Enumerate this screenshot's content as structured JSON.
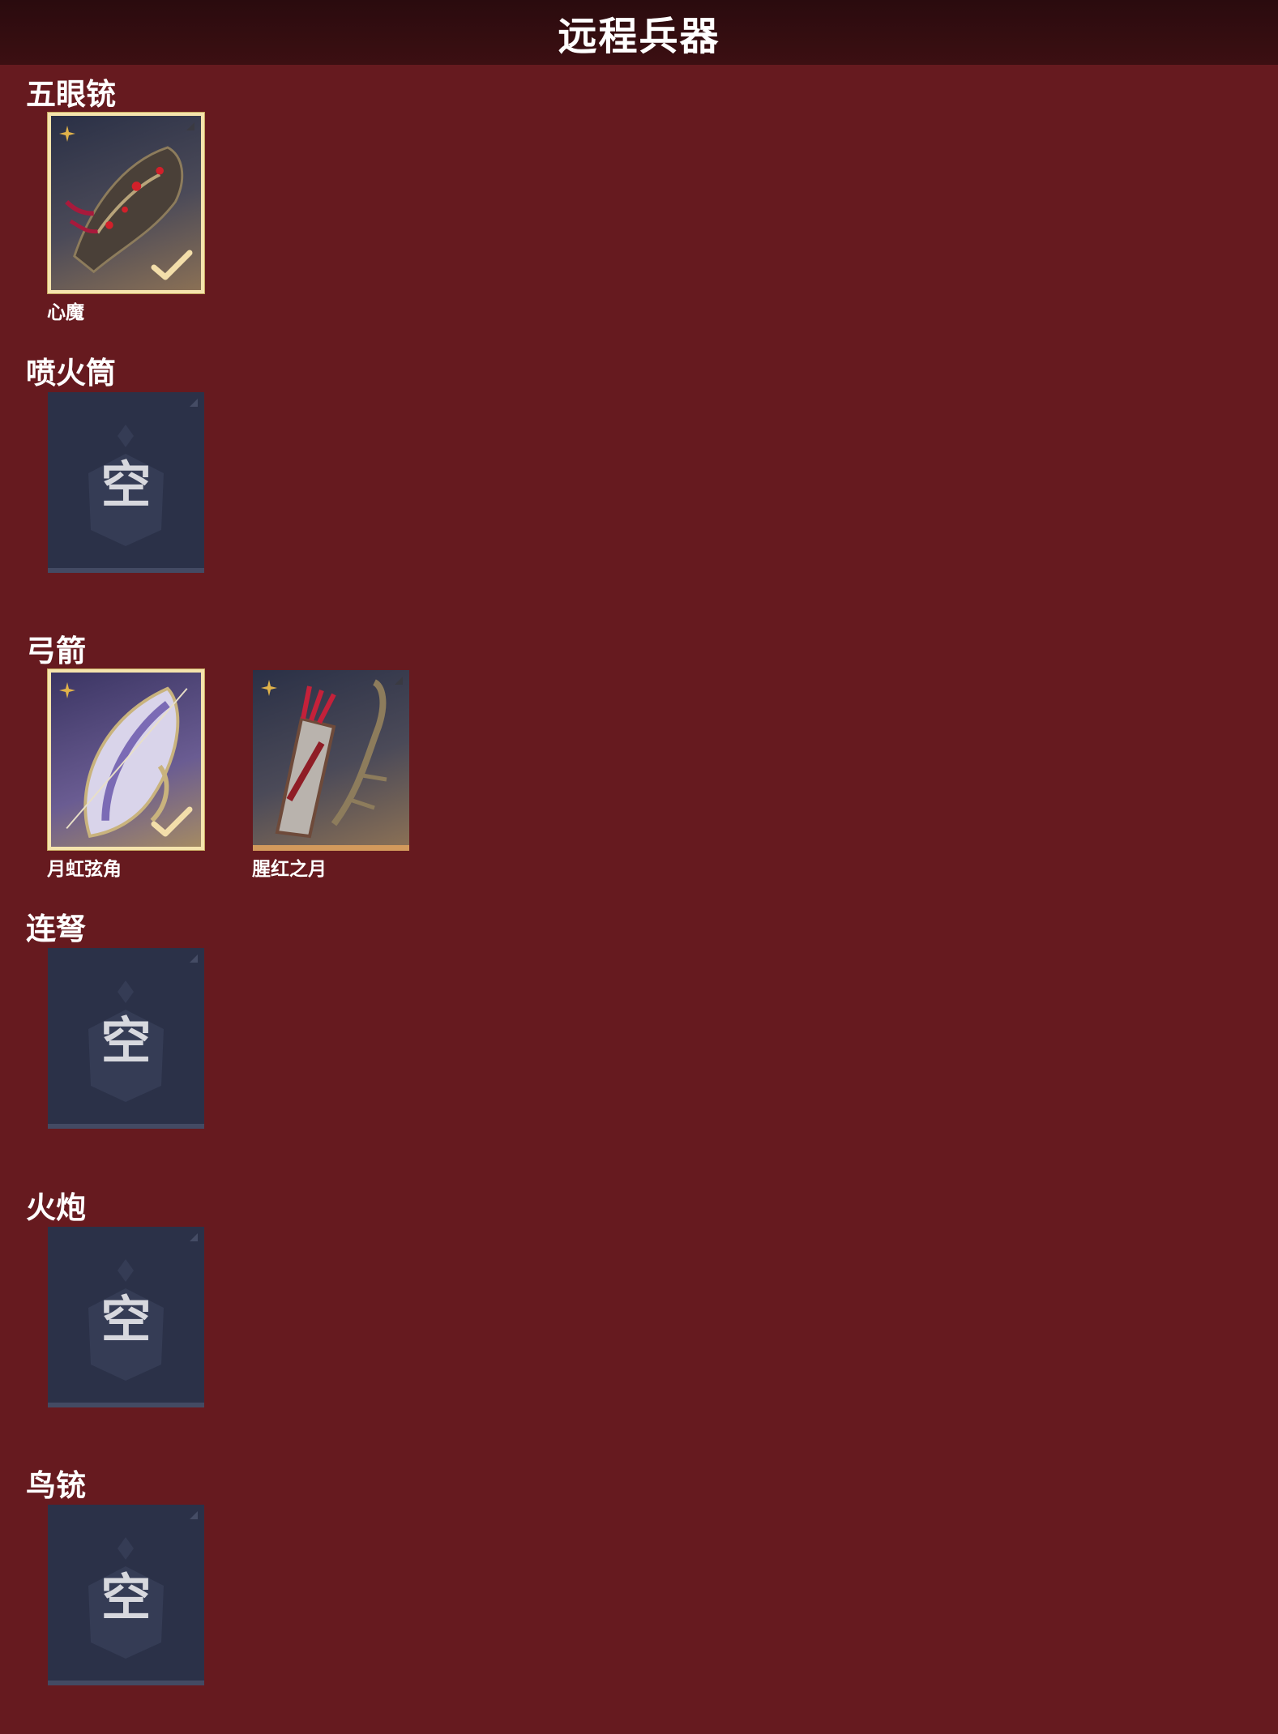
{
  "header": {
    "title": "远程兵器"
  },
  "colors": {
    "background": "#661a1f",
    "slot": "#2b3148",
    "selected_border": "#f5e4ad",
    "accent_bar": "#d39a5c"
  },
  "sections": [
    {
      "label": "五眼铳",
      "items": [
        {
          "name": "心魔",
          "selected": true,
          "icons": [
            "star-icon",
            "check-icon"
          ]
        }
      ]
    },
    {
      "label": "喷火筒",
      "empty_label": "空"
    },
    {
      "label": "弓箭",
      "items": [
        {
          "name": "月虹弦角",
          "selected": true,
          "icons": [
            "star-icon",
            "check-icon"
          ]
        },
        {
          "name": "腥红之月",
          "selected": false,
          "icons": [
            "star-icon"
          ]
        }
      ]
    },
    {
      "label": "连弩",
      "empty_label": "空"
    },
    {
      "label": "火炮",
      "empty_label": "空"
    },
    {
      "label": "鸟铳",
      "empty_label": "空"
    }
  ]
}
